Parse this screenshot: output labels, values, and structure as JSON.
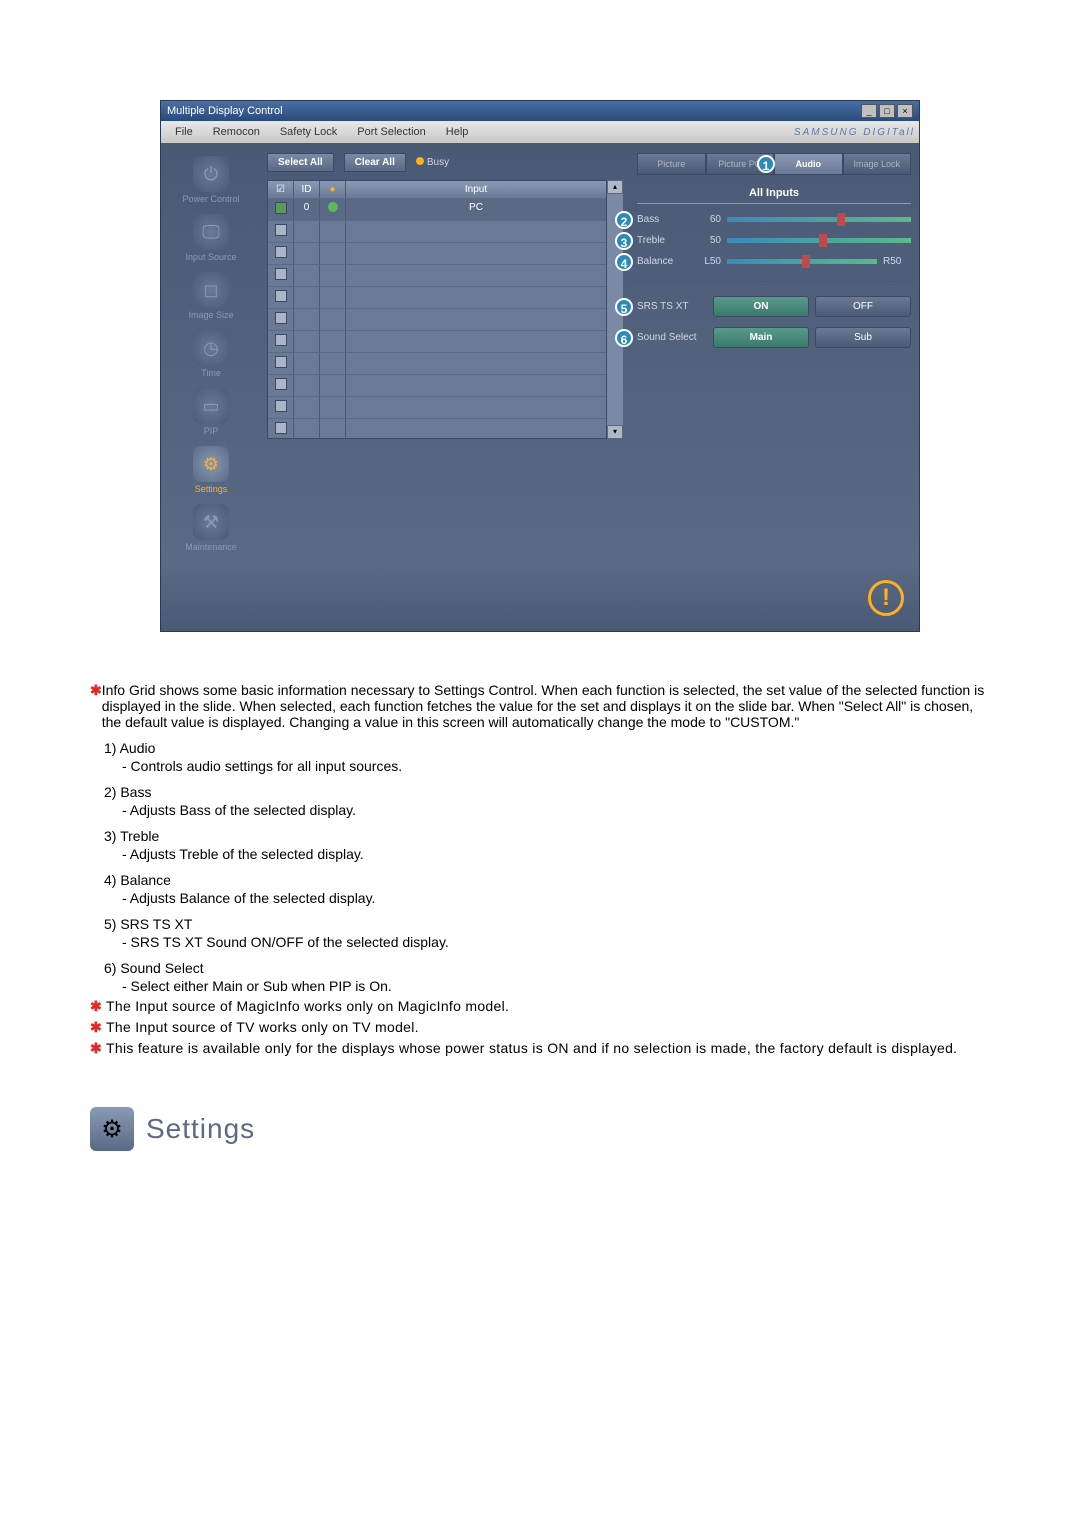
{
  "window": {
    "title": "Multiple Display Control",
    "min": "_",
    "max": "□",
    "close": "×"
  },
  "menubar": {
    "items": [
      "File",
      "Remocon",
      "Safety Lock",
      "Port Selection",
      "Help"
    ],
    "brand": "SAMSUNG DIGITall"
  },
  "sidebar": {
    "items": [
      {
        "label": "Power Control",
        "glyph": "⏻"
      },
      {
        "label": "Input Source",
        "glyph": "🖵"
      },
      {
        "label": "Image Size",
        "glyph": "◻"
      },
      {
        "label": "Time",
        "glyph": "◷"
      },
      {
        "label": "PIP",
        "glyph": "▭"
      },
      {
        "label": "Settings",
        "glyph": "⚙"
      },
      {
        "label": "Maintenance",
        "glyph": "⚒"
      }
    ],
    "activeIndex": 5
  },
  "toolbar": {
    "selectAll": "Select All",
    "clearAll": "Clear All",
    "busy": "Busy"
  },
  "grid": {
    "headers": {
      "chk": "☑",
      "id": "ID",
      "status": "●",
      "input": "Input"
    },
    "rows": [
      {
        "chk": true,
        "id": "0",
        "status": "green",
        "input": "PC"
      },
      {
        "chk": false,
        "id": "",
        "status": "",
        "input": ""
      },
      {
        "chk": false,
        "id": "",
        "status": "",
        "input": ""
      },
      {
        "chk": false,
        "id": "",
        "status": "",
        "input": ""
      },
      {
        "chk": false,
        "id": "",
        "status": "",
        "input": ""
      },
      {
        "chk": false,
        "id": "",
        "status": "",
        "input": ""
      },
      {
        "chk": false,
        "id": "",
        "status": "",
        "input": ""
      },
      {
        "chk": false,
        "id": "",
        "status": "",
        "input": ""
      },
      {
        "chk": false,
        "id": "",
        "status": "",
        "input": ""
      },
      {
        "chk": false,
        "id": "",
        "status": "",
        "input": ""
      },
      {
        "chk": false,
        "id": "",
        "status": "",
        "input": ""
      }
    ]
  },
  "tabs": {
    "items": [
      "Picture",
      "Picture PC",
      "Audio",
      "Image Lock"
    ],
    "activeIndex": 2
  },
  "audio": {
    "sectionTitle": "All Inputs",
    "sliders": [
      {
        "callout": "2",
        "label": "Bass",
        "value": "60",
        "pos": 60
      },
      {
        "callout": "3",
        "label": "Treble",
        "value": "50",
        "pos": 50
      },
      {
        "callout": "4",
        "label": "Balance",
        "leftLabel": "L50",
        "rightLabel": "R50",
        "pos": 50
      }
    ],
    "srs": {
      "callout": "5",
      "label": "SRS TS XT",
      "on": "ON",
      "off": "OFF",
      "active": "on"
    },
    "soundSelect": {
      "callout": "6",
      "label": "Sound Select",
      "main": "Main",
      "sub": "Sub",
      "active": "main"
    }
  },
  "tabCallout": "1",
  "notes": {
    "intro": "Info Grid shows some basic information necessary to Settings Control. When each function is selected, the set value of the selected function is displayed in the slide. When selected, each function fetches the value for the set and displays it on the slide bar. When \"Select All\" is chosen, the default value is displayed. Changing a value in this screen will automatically change the mode to \"CUSTOM.\"",
    "list": [
      {
        "n": "1)",
        "t": "Audio",
        "d": "- Controls audio settings for all input sources."
      },
      {
        "n": "2)",
        "t": "Bass",
        "d": "- Adjusts Bass of the selected display."
      },
      {
        "n": "3)",
        "t": "Treble",
        "d": "- Adjusts Treble of the selected display."
      },
      {
        "n": "4)",
        "t": "Balance",
        "d": "- Adjusts Balance of the selected display."
      },
      {
        "n": "5)",
        "t": "SRS TS XT",
        "d": "- SRS TS XT Sound ON/OFF of the selected display."
      },
      {
        "n": "6)",
        "t": "Sound Select",
        "d": "- Select either Main or Sub when PIP is On."
      }
    ],
    "warnings": [
      "The Input source of MagicInfo works only on MagicInfo model.",
      "The Input source of TV works only on TV model.",
      "This feature is available only for the displays whose power status is ON and if no selection is made, the factory default is displayed."
    ]
  },
  "settingsTitle": "Settings"
}
